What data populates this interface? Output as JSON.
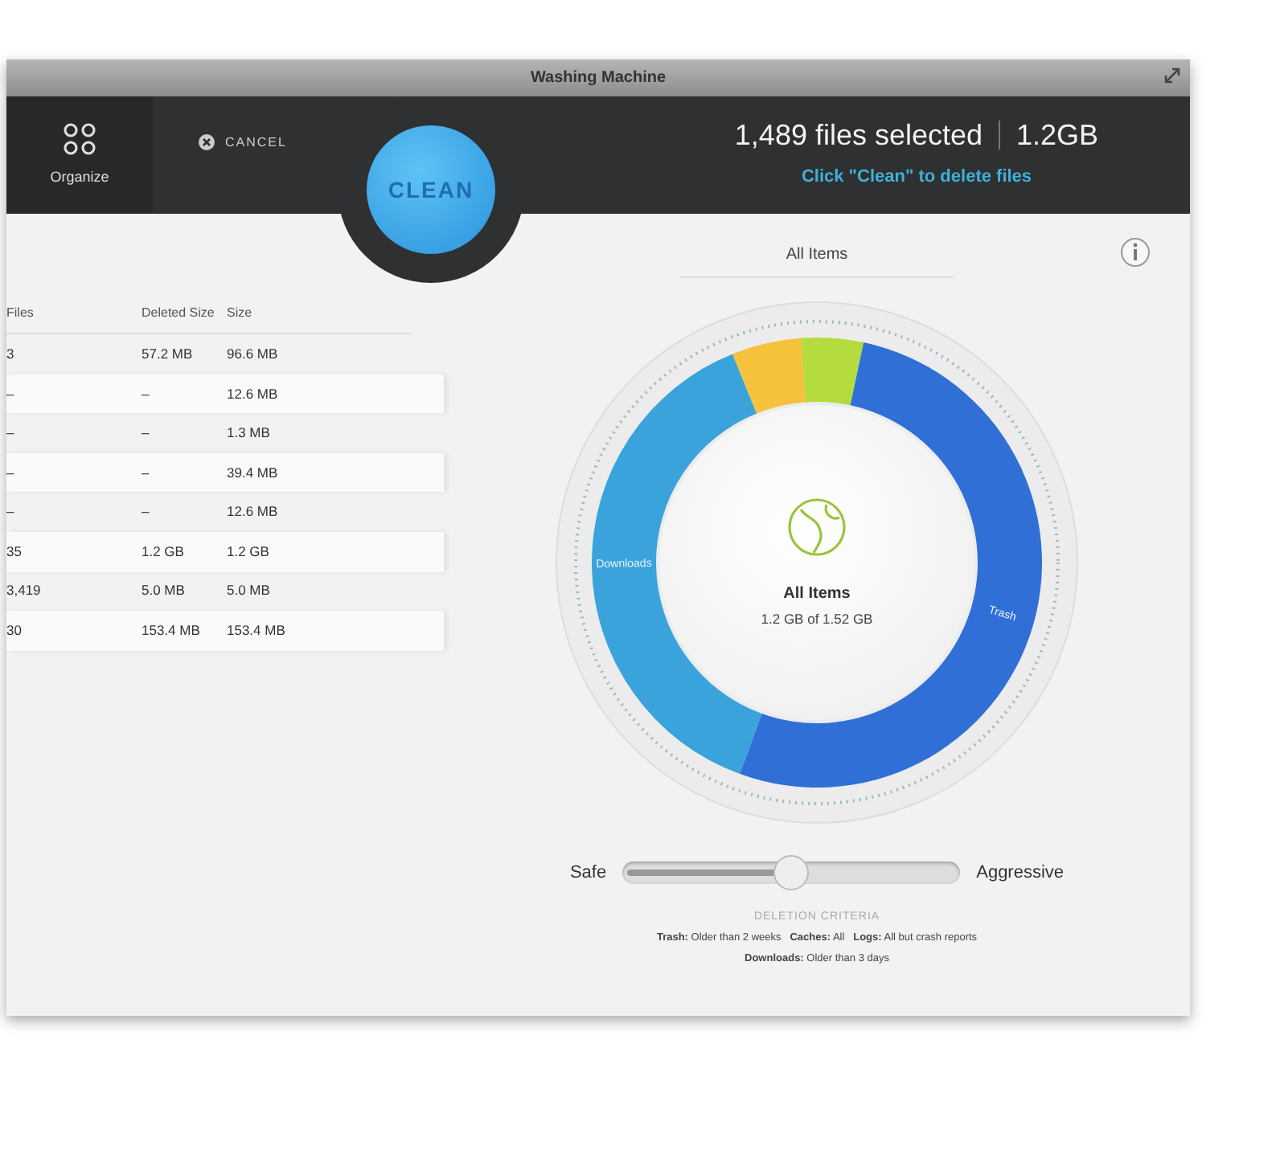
{
  "window": {
    "title": "Washing Machine"
  },
  "toolbar": {
    "organize": {
      "label": "Organize"
    },
    "cancel": {
      "label": "CANCEL"
    },
    "clean": {
      "label": "CLEAN"
    },
    "summary": {
      "files": "1,489 files selected",
      "size": "1.2GB",
      "hint": "Click \"Clean\" to delete files"
    }
  },
  "table": {
    "columns": [
      "Files",
      "Deleted Size",
      "Size"
    ],
    "rows": [
      [
        "3",
        "57.2 MB",
        "96.6 MB"
      ],
      [
        "–",
        "–",
        "12.6 MB"
      ],
      [
        "–",
        "–",
        "1.3 MB"
      ],
      [
        "–",
        "–",
        "39.4 MB"
      ],
      [
        "–",
        "–",
        "12.6 MB"
      ],
      [
        "35",
        "1.2 GB",
        "1.2 GB"
      ],
      [
        "3,419",
        "5.0 MB",
        "5.0 MB"
      ],
      [
        "30",
        "153.4 MB",
        "153.4 MB"
      ]
    ]
  },
  "gauge": {
    "heading": "All Items",
    "center_title": "All Items",
    "center_detail": "1.2 GB of 1.52 GB",
    "segments": [
      {
        "label": "Downloads",
        "color": "#3aa3dc"
      },
      {
        "color": "#f5c23c"
      },
      {
        "color": "#b5dc3e"
      },
      {
        "label": "Trash",
        "color": "#2f6fd6"
      }
    ]
  },
  "slider": {
    "min_label": "Safe",
    "max_label": "Aggressive",
    "level": 0.5
  },
  "criteria": {
    "heading": "DELETION CRITERIA",
    "lines": [
      "**Trash:** Older than 2 weeks   **Caches:** All   **Logs:** All but crash reports",
      "**Downloads:** Older than 3 days"
    ]
  }
}
